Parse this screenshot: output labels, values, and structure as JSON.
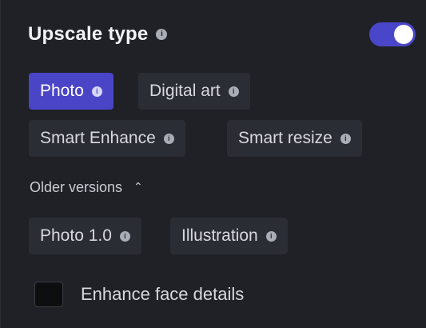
{
  "header": {
    "title": "Upscale type",
    "info_icon": "info-icon",
    "toggle_on": true
  },
  "upscale_types": [
    {
      "label": "Photo",
      "active": true
    },
    {
      "label": "Digital art",
      "active": false
    },
    {
      "label": "Smart Enhance",
      "active": false
    },
    {
      "label": "Smart resize",
      "active": false
    }
  ],
  "older": {
    "label": "Older versions",
    "expanded": true,
    "chevron_icon": "chevron-up-icon"
  },
  "older_types": [
    {
      "label": "Photo 1.0",
      "active": false
    },
    {
      "label": "Illustration",
      "active": false
    }
  ],
  "enhance_face": {
    "label": "Enhance face details",
    "checked": false
  },
  "colors": {
    "accent": "#4a45c7",
    "panel": "#1f2127",
    "chip": "#2a2d34"
  }
}
